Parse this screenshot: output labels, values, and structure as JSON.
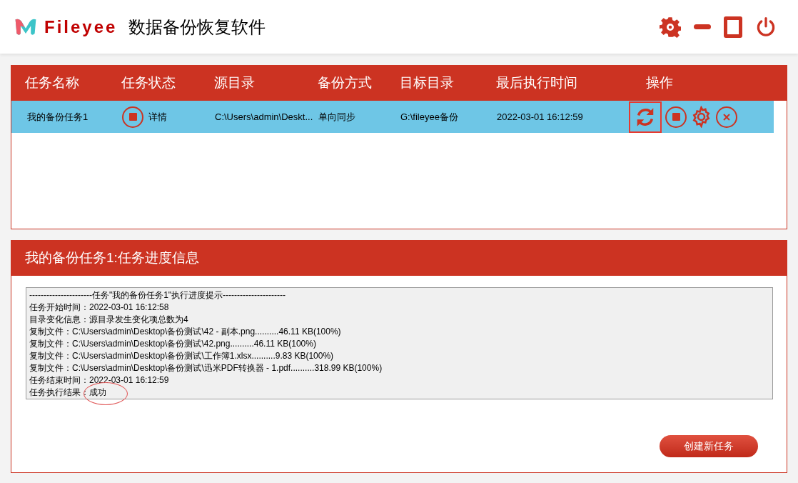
{
  "app": {
    "logo_text": "Fileyee",
    "title": "数据备份恢复软件"
  },
  "task_table": {
    "columns": [
      "任务名称",
      "任务状态",
      "源目录",
      "备份方式",
      "目标目录",
      "最后执行时间",
      "操作"
    ],
    "rows": [
      {
        "name": "我的备份任务1",
        "status_link": "详情",
        "source": "C:\\Users\\admin\\Deskt...",
        "method": "单向同步",
        "target": "G:\\fileyee备份",
        "last_run": "2022-03-01 16:12:59",
        "selected": true,
        "refresh_highlighted": true
      }
    ]
  },
  "progress_panel": {
    "title": "我的备份任务1:任务进度信息",
    "log_lines": [
      {
        "text": "----------------------任务\"我的备份任务1\"执行进度提示----------------------"
      },
      {
        "label": "任务开始时间：",
        "value": "2022-03-01 16:12:58",
        "circled": false
      },
      {
        "label": "目录变化信息：",
        "value": "源目录发生变化项总数为4",
        "circled": false
      },
      {
        "label": "复制文件：",
        "value": "C:\\Users\\admin\\Desktop\\备份测试\\42 - 副本.png..........46.11 KB(100%)",
        "circled": false
      },
      {
        "label": "复制文件：",
        "value": "C:\\Users\\admin\\Desktop\\备份测试\\42.png..........46.11 KB(100%)",
        "circled": false
      },
      {
        "label": "复制文件：",
        "value": "C:\\Users\\admin\\Desktop\\备份测试\\工作簿1.xlsx..........9.83 KB(100%)",
        "circled": false
      },
      {
        "label": "复制文件：",
        "value": "C:\\Users\\admin\\Desktop\\备份测试\\迅米PDF转换器 - 1.pdf..........318.99 KB(100%)",
        "circled": false
      },
      {
        "label": "任务结束时间：",
        "value": "2022-03-01 16:12:59",
        "circled": false
      },
      {
        "label": "任务执行结果：",
        "value": "成功",
        "circled": true
      }
    ],
    "new_task_button": "创建新任务"
  }
}
